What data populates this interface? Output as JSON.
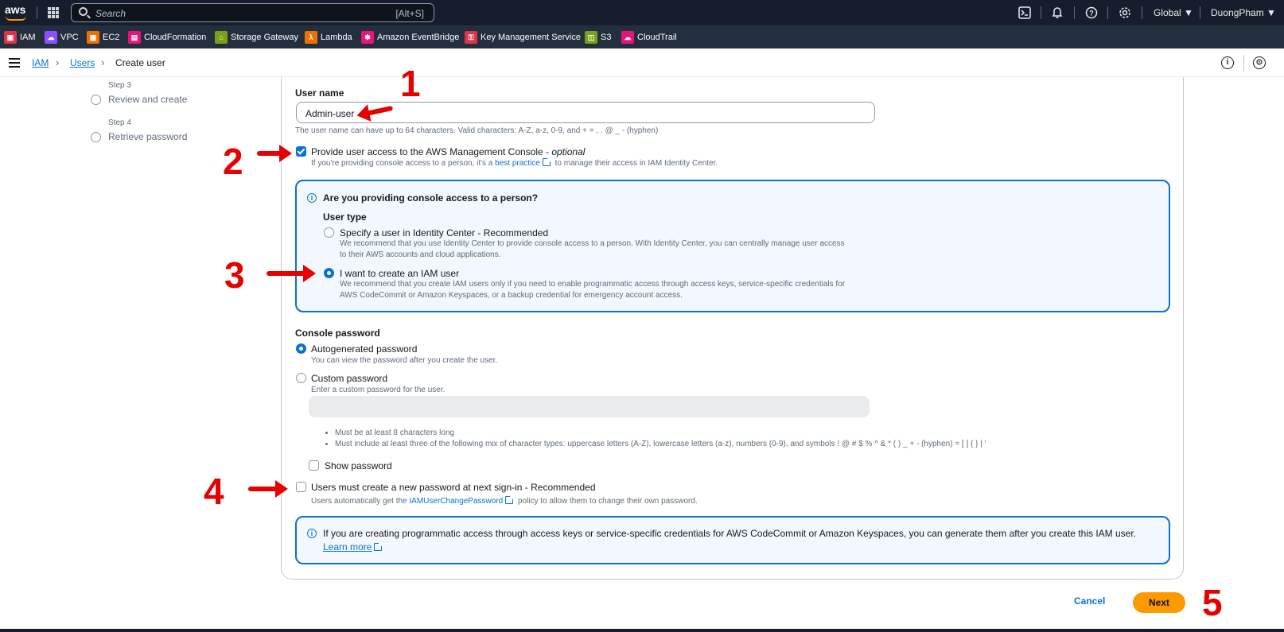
{
  "topnav": {
    "logo": "aws",
    "search_placeholder": "Search",
    "search_shortcut": "[Alt+S]",
    "region": "Global ▼",
    "account": "DuongPham ▼",
    "icons": [
      "cloudshell-icon",
      "bell-icon",
      "help-icon",
      "settings-icon"
    ]
  },
  "favorites": [
    {
      "label": "IAM",
      "color": "#dd344c"
    },
    {
      "label": "VPC",
      "color": "#8c4fff"
    },
    {
      "label": "EC2",
      "color": "#ed7100"
    },
    {
      "label": "CloudFormation",
      "color": "#e7157b"
    },
    {
      "label": "Storage Gateway",
      "color": "#7aa116"
    },
    {
      "label": "Lambda",
      "color": "#ed7100"
    },
    {
      "label": "Amazon EventBridge",
      "color": "#e7157b"
    },
    {
      "label": "Key Management Service",
      "color": "#dd344c"
    },
    {
      "label": "S3",
      "color": "#7aa116"
    },
    {
      "label": "CloudTrail",
      "color": "#e7157b"
    }
  ],
  "breadcrumb": {
    "iam": "IAM",
    "users": "Users",
    "current": "Create user"
  },
  "steps": [
    {
      "label": "Step 3",
      "title": "Review and create"
    },
    {
      "label": "Step 4",
      "title": "Retrieve password"
    }
  ],
  "form": {
    "username_label": "User name",
    "username_value": "Admin-user",
    "username_hint": "The user name can have up to 64 characters. Valid characters: A-Z, a-z, 0-9, and + = , . @ _ - (hyphen)",
    "console_access_label": "Provide user access to the AWS Management Console - ",
    "console_access_optional": "optional",
    "console_access_desc_pre": "If you're providing console access to a person, it's a ",
    "console_access_desc_link": "best practice",
    "console_access_desc_post": " to manage their access in IAM Identity Center.",
    "info_title": "Are you providing console access to a person?",
    "user_type_label": "User type",
    "opt_identity_label": "Specify a user in Identity Center - Recommended",
    "opt_identity_desc1": "We recommend that you use Identity Center to provide console access to a person. With Identity Center, you can centrally manage user access",
    "opt_identity_desc2": "to their AWS accounts and cloud applications.",
    "opt_iam_label": "I want to create an IAM user",
    "opt_iam_desc1": "We recommend that you create IAM users only if you need to enable programmatic access through access keys, service-specific credentials for",
    "opt_iam_desc2": "AWS CodeCommit or Amazon Keyspaces, or a backup credential for emergency account access.",
    "console_password_label": "Console password",
    "autogen_label": "Autogenerated password",
    "autogen_desc": "You can view the password after you create the user.",
    "custom_label": "Custom password",
    "custom_desc": "Enter a custom password for the user.",
    "rule1": "Must be at least 8 characters long",
    "rule2": "Must include at least three of the following mix of character types: uppercase letters (A-Z), lowercase letters (a-z), numbers (0-9), and symbols ! @ # $ % ^ & * ( ) _ + - (hyphen) = [ ] { } | '",
    "show_password_label": "Show password",
    "reset_label": "Users must create a new password at next sign-in - Recommended",
    "reset_desc_pre": "Users automatically get the ",
    "reset_desc_link": "IAMUserChangePassword",
    "reset_desc_post": " policy to allow them to change their own password.",
    "note_text": "If you are creating programmatic access through access keys or service-specific credentials for AWS CodeCommit or Amazon Keyspaces, you can generate them after you create this IAM user.",
    "note_link": "Learn more"
  },
  "actions": {
    "cancel": "Cancel",
    "next": "Next"
  },
  "annotations": [
    "1",
    "2",
    "3",
    "4",
    "5"
  ],
  "colors": {
    "accent": "#0972d3",
    "primary_button": "#ff9900",
    "annotation": "#e60000",
    "nav_bg": "#161e2d"
  }
}
